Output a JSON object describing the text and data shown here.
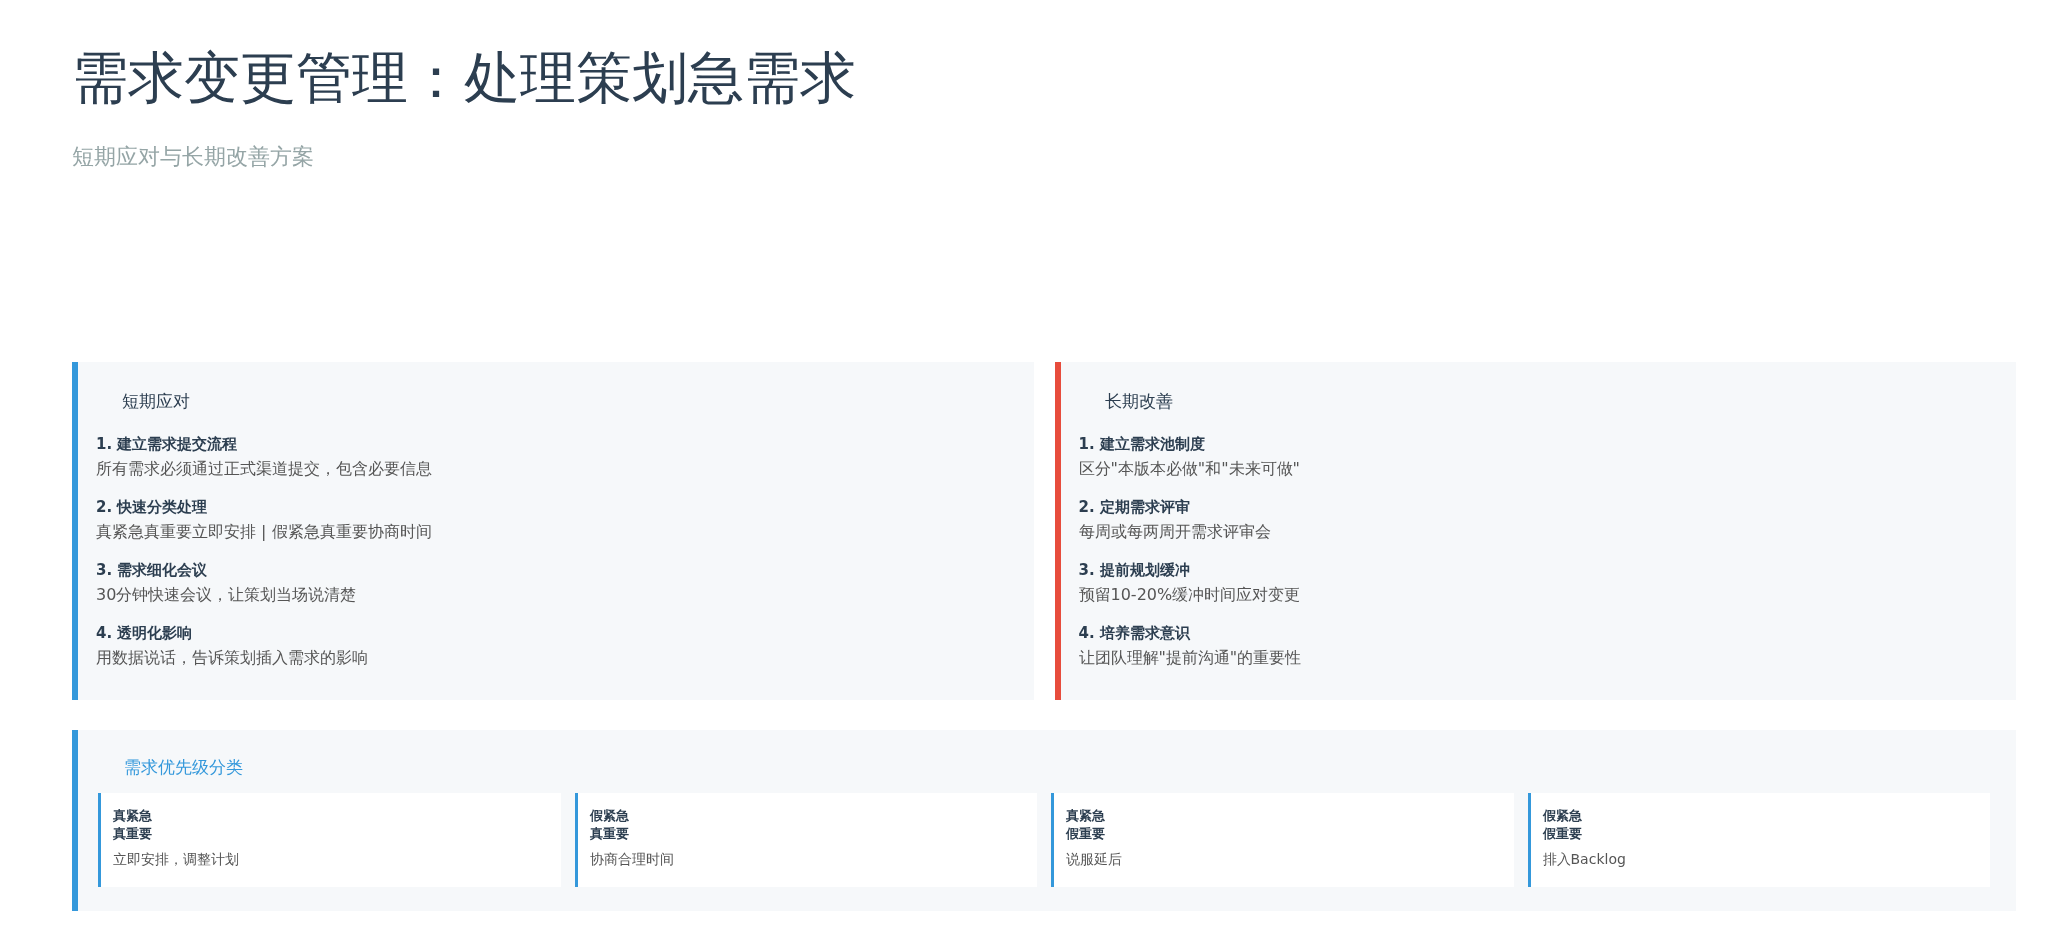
{
  "title": "需求变更管理：处理策划急需求",
  "subtitle": "短期应对与长期改善方案",
  "sections": [
    {
      "title": "短期应对",
      "color": "#3498db",
      "items": [
        {
          "heading": "1. 建立需求提交流程",
          "text": "所有需求必须通过正式渠道提交，包含必要信息"
        },
        {
          "heading": "2. 快速分类处理",
          "text": "真紧急真重要立即安排 | 假紧急真重要协商时间"
        },
        {
          "heading": "3. 需求细化会议",
          "text": "30分钟快速会议，让策划当场说清楚"
        },
        {
          "heading": "4. 透明化影响",
          "text": "用数据说话，告诉策划插入需求的影响"
        }
      ]
    },
    {
      "title": "长期改善",
      "color": "#e74c3c",
      "items": [
        {
          "heading": "1. 建立需求池制度",
          "text": "区分\"本版本必做\"和\"未来可做\""
        },
        {
          "heading": "2. 定期需求评审",
          "text": "每周或每两周开需求评审会"
        },
        {
          "heading": "3. 提前规划缓冲",
          "text": "预留10-20%缓冲时间应对变更"
        },
        {
          "heading": "4. 培养需求意识",
          "text": "让团队理解\"提前沟通\"的重要性"
        }
      ]
    }
  ],
  "priority": {
    "title": "需求优先级分类",
    "quadrants": [
      {
        "urgency": "真紧急",
        "importance": "真重要",
        "action": "立即安排，调整计划"
      },
      {
        "urgency": "假紧急",
        "importance": "真重要",
        "action": "协商合理时间"
      },
      {
        "urgency": "真紧急",
        "importance": "假重要",
        "action": "说服延后"
      },
      {
        "urgency": "假紧急",
        "importance": "假重要",
        "action": "排入Backlog"
      }
    ]
  }
}
